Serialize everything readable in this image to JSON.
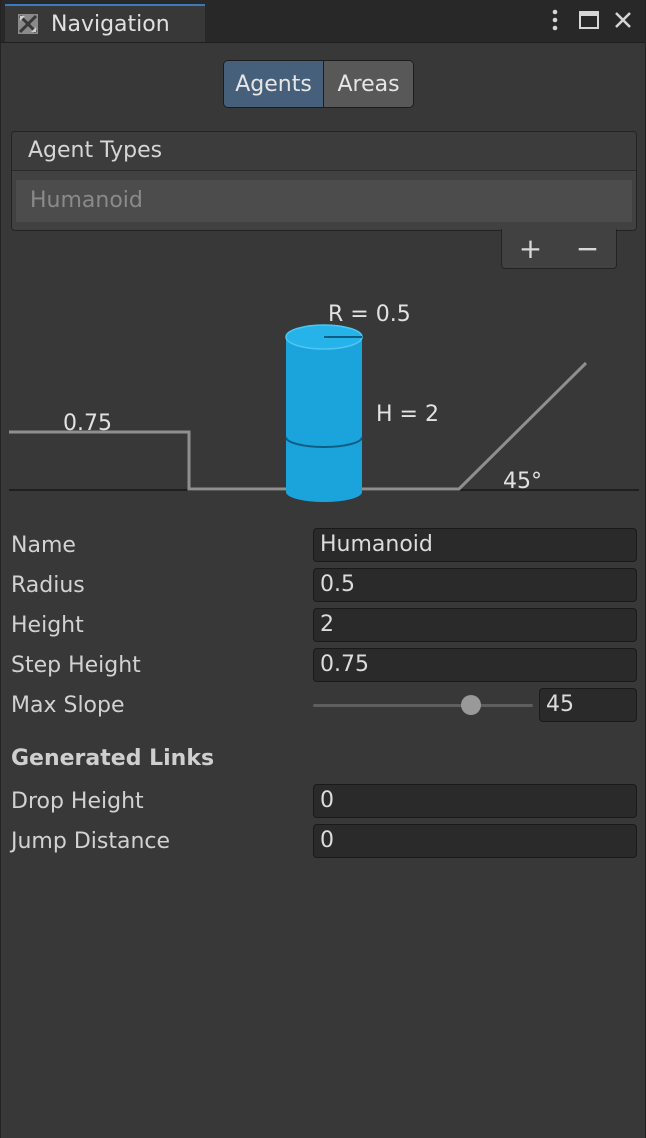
{
  "window": {
    "tab_title": "Navigation",
    "icons": [
      "navigation-icon",
      "more-vert-icon",
      "maximize-icon",
      "close-icon"
    ]
  },
  "segments": {
    "agents": "Agents",
    "areas": "Areas",
    "selected": "Agents"
  },
  "agent_types": {
    "header": "Agent Types",
    "items": [
      "Humanoid"
    ],
    "add_label": "+",
    "remove_label": "−"
  },
  "diagram": {
    "radius_label": "R = 0.5",
    "height_label": "H = 2",
    "step_label": "0.75",
    "slope_label": "45°",
    "cylinder_color": "#1ba4dc"
  },
  "properties": {
    "name": {
      "label": "Name",
      "value": "Humanoid"
    },
    "radius": {
      "label": "Radius",
      "value": "0.5"
    },
    "height": {
      "label": "Height",
      "value": "2"
    },
    "step_height": {
      "label": "Step Height",
      "value": "0.75"
    },
    "max_slope": {
      "label": "Max Slope",
      "value": "45",
      "slider_fraction": 0.72
    }
  },
  "generated_links": {
    "title": "Generated Links",
    "drop_height": {
      "label": "Drop Height",
      "value": "0"
    },
    "jump_distance": {
      "label": "Jump Distance",
      "value": "0"
    }
  }
}
